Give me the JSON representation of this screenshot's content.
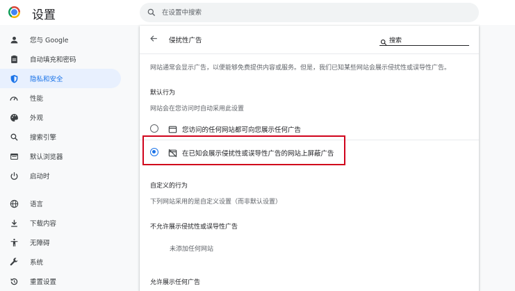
{
  "app": {
    "title": "设置"
  },
  "search": {
    "placeholder": "在设置中搜索"
  },
  "sidebar": {
    "items": [
      {
        "label": "您与 Google",
        "icon": "person-icon"
      },
      {
        "label": "自动填充和密码",
        "icon": "clipboard-icon"
      },
      {
        "label": "隐私和安全",
        "icon": "shield-icon",
        "active": true
      },
      {
        "label": "性能",
        "icon": "speedometer-icon"
      },
      {
        "label": "外观",
        "icon": "palette-icon"
      },
      {
        "label": "搜索引擎",
        "icon": "search-icon"
      },
      {
        "label": "默认浏览器",
        "icon": "browser-icon"
      },
      {
        "label": "启动时",
        "icon": "power-icon"
      },
      {
        "label": "语言",
        "icon": "globe-icon"
      },
      {
        "label": "下载内容",
        "icon": "download-icon"
      },
      {
        "label": "无障碍",
        "icon": "accessibility-icon"
      },
      {
        "label": "系统",
        "icon": "wrench-icon"
      },
      {
        "label": "重置设置",
        "icon": "reset-icon"
      }
    ]
  },
  "page": {
    "title": "侵扰性广告",
    "search_label": "搜索",
    "description": "网站通常会显示广告，以便能够免费提供内容或服务。但是，我们已知某些网站会展示侵扰性或误导性广告。",
    "default_behavior": {
      "heading": "默认行为",
      "subheading": "网站会在您访问时自动采用此设置",
      "options": [
        {
          "label": "您访问的任何网站都可向您展示任何广告",
          "icon": "window-icon",
          "checked": false
        },
        {
          "label": "在已知会展示侵扰性或误导性广告的网站上屏蔽广告",
          "icon": "ads-blocked-icon",
          "checked": true
        }
      ]
    },
    "custom_behavior": {
      "heading": "自定义的行为",
      "subheading": "下列网站采用的是自定义设置（而非默认设置）",
      "blocked_heading": "不允许展示侵扰性或误导性广告",
      "blocked_empty": "未添加任何网站",
      "allowed_heading": "允许展示任何广告"
    }
  },
  "colors": {
    "accent": "#1a73e8",
    "active_bg": "#e8f0fe",
    "highlight_border": "#d0021b"
  }
}
